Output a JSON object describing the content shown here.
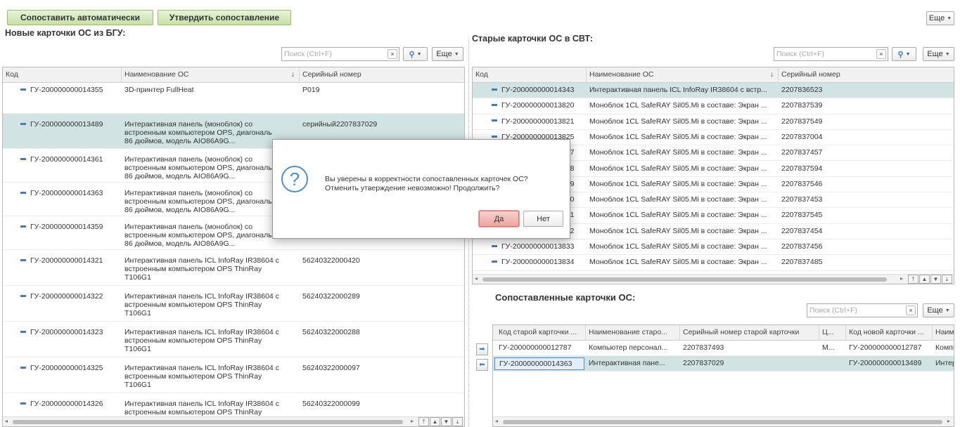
{
  "toolbar": {
    "auto_match_label": "Сопоставить автоматически",
    "confirm_match_label": "Утвердить сопоставление",
    "more_label": "Еще"
  },
  "left_panel": {
    "title": "Новые карточки ОС из БГУ:",
    "search_placeholder": "Поиск (Ctrl+F)",
    "more_label": "Еще",
    "columns": [
      "Код",
      "Наименование ОС",
      "Серийный номер"
    ],
    "rows": [
      {
        "code": "ГУ-200000000014355",
        "name": "3D-принтер FullHeat",
        "serial": "P019"
      },
      {
        "code": "ГУ-200000000013489",
        "name": "Интерактивная панель (моноблок) со встроенным компьютером OPS, диагональ 86 дюймов, модель AIO86A9G...",
        "serial": "серийный2207837029"
      },
      {
        "code": "ГУ-200000000014361",
        "name": "Интерактивная панель (моноблок) со встроенным компьютером OPS, диагональ 86 дюймов, модель AIO86A9G...",
        "serial": ""
      },
      {
        "code": "ГУ-200000000014363",
        "name": "Интерактивная панель (моноблок) со встроенным компьютером OPS, диагональ 86 дюймов, модель AIO86A9G...",
        "serial": ""
      },
      {
        "code": "ГУ-200000000014359",
        "name": "Интерактивная панель (моноблок) со встроенным компьютером OPS, диагональ 86 дюймов, модель AIO86A9G...",
        "serial": ""
      },
      {
        "code": "ГУ-200000000014321",
        "name": "Интерактивная панель ICL InfoRay IR38604 с встроенным компьютером OPS ThinRay T106G1",
        "serial": "56240322000420"
      },
      {
        "code": "ГУ-200000000014322",
        "name": "Интерактивная панель ICL InfoRay IR38604 с встроенным компьютером OPS ThinRay T106G1",
        "serial": "56240322000289"
      },
      {
        "code": "ГУ-200000000014323",
        "name": "Интерактивная панель ICL InfoRay IR38604 с встроенным компьютером OPS ThinRay T106G1",
        "serial": "56240322000288"
      },
      {
        "code": "ГУ-200000000014325",
        "name": "Интерактивная панель ICL InfoRay IR38604 с встроенным компьютером OPS ThinRay T106G1",
        "serial": "56240322000097"
      },
      {
        "code": "ГУ-200000000014326",
        "name": "Интерактивная панель ICL InfoRay IR38604 с встроенным компьютером OPS ThinRay",
        "serial": "56240322000099"
      }
    ]
  },
  "right_panel": {
    "title": "Старые карточки ОС в СВТ:",
    "search_placeholder": "Поиск (Ctrl+F)",
    "more_label": "Еще",
    "columns": [
      "Код",
      "Наименование ОС",
      "Серийный номер"
    ],
    "rows": [
      {
        "code": "ГУ-200000000014343",
        "name": "Интерактивная панель ICL InfoRay IR38604 с встр...",
        "serial": "2207836523"
      },
      {
        "code": "ГУ-200000000013820",
        "name": "Моноблок 1CL SafeRAY Sil05.Mi в составе: Экран ...",
        "serial": "2207837539"
      },
      {
        "code": "ГУ-200000000013821",
        "name": "Моноблок 1CL SafeRAY Sil05.Mi в составе: Экран ...",
        "serial": "2207837549"
      },
      {
        "code": "ГУ-200000000013825",
        "name": "Моноблок 1CL SafeRAY Sil05.Mi в составе: Экран ...",
        "serial": "2207837004"
      },
      {
        "code": "ГУ-200000000013827",
        "name": "Моноблок 1CL SafeRAY Sil05.Mi в составе: Экран ...",
        "serial": "2207837457"
      },
      {
        "code": "ГУ-200000000013828",
        "name": "Моноблок 1CL SafeRAY Sil05.Mi в составе: Экран ...",
        "serial": "2207837594"
      },
      {
        "code": "ГУ-200000000013829",
        "name": "Моноблок 1CL SafeRAY Sil05.Mi в составе: Экран ...",
        "serial": "2207837546"
      },
      {
        "code": "ГУ-200000000013830",
        "name": "Моноблок 1CL SafeRAY Sil05.Mi в составе: Экран ...",
        "serial": "2207837453"
      },
      {
        "code": "ГУ-200000000013831",
        "name": "Моноблок 1CL SafeRAY Sil05.Mi в составе: Экран ...",
        "serial": "2207837545"
      },
      {
        "code": "ГУ-200000000013832",
        "name": "Моноблок 1CL SafeRAY Sil05.Mi в составе: Экран ...",
        "serial": "2207837454"
      },
      {
        "code": "ГУ-200000000013833",
        "name": "Моноблок 1CL SafeRAY Sil05.Mi в составе: Экран ...",
        "serial": "2207837456"
      },
      {
        "code": "ГУ-200000000013834",
        "name": "Моноблок 1CL SafeRAY Sil05.Mi в составе: Экран ...",
        "serial": "2207837485"
      }
    ]
  },
  "matched_panel": {
    "title": "Сопоставленные карточки ОС:",
    "search_placeholder": "Поиск (Ctrl+F)",
    "more_label": "Еще",
    "columns": [
      "Код старой карточки ...",
      "Наименование старо...",
      "Серийный номер старой карточки",
      "Ц...",
      "Код новой карточки ...",
      "Наим"
    ],
    "rows": [
      {
        "old_code": "ГУ-200000000012787",
        "old_name": "Компьютер персонал...",
        "old_serial": "2207837493",
        "c": "М...",
        "new_code": "ГУ-200000000012787",
        "new_name": "Компь"
      },
      {
        "old_code": "ГУ-200000000014363",
        "old_name": "Интерактивная пане...",
        "old_serial": "2207837029",
        "c": "",
        "new_code": "ГУ-200000000013489",
        "new_name": "Интер"
      }
    ]
  },
  "dialog": {
    "message_line1": "Вы уверены в корректности сопоставленных карточек ОС?",
    "message_line2": "Отменить утверждение невозможно! Продолжить?",
    "yes_label": "Да",
    "no_label": "Нет"
  },
  "colors": {
    "accent_green": "#c6e0a4",
    "selected_row": "#d2e3e3",
    "dash_blue": "#4a78b5",
    "yes_button": "#f3b8b5"
  }
}
